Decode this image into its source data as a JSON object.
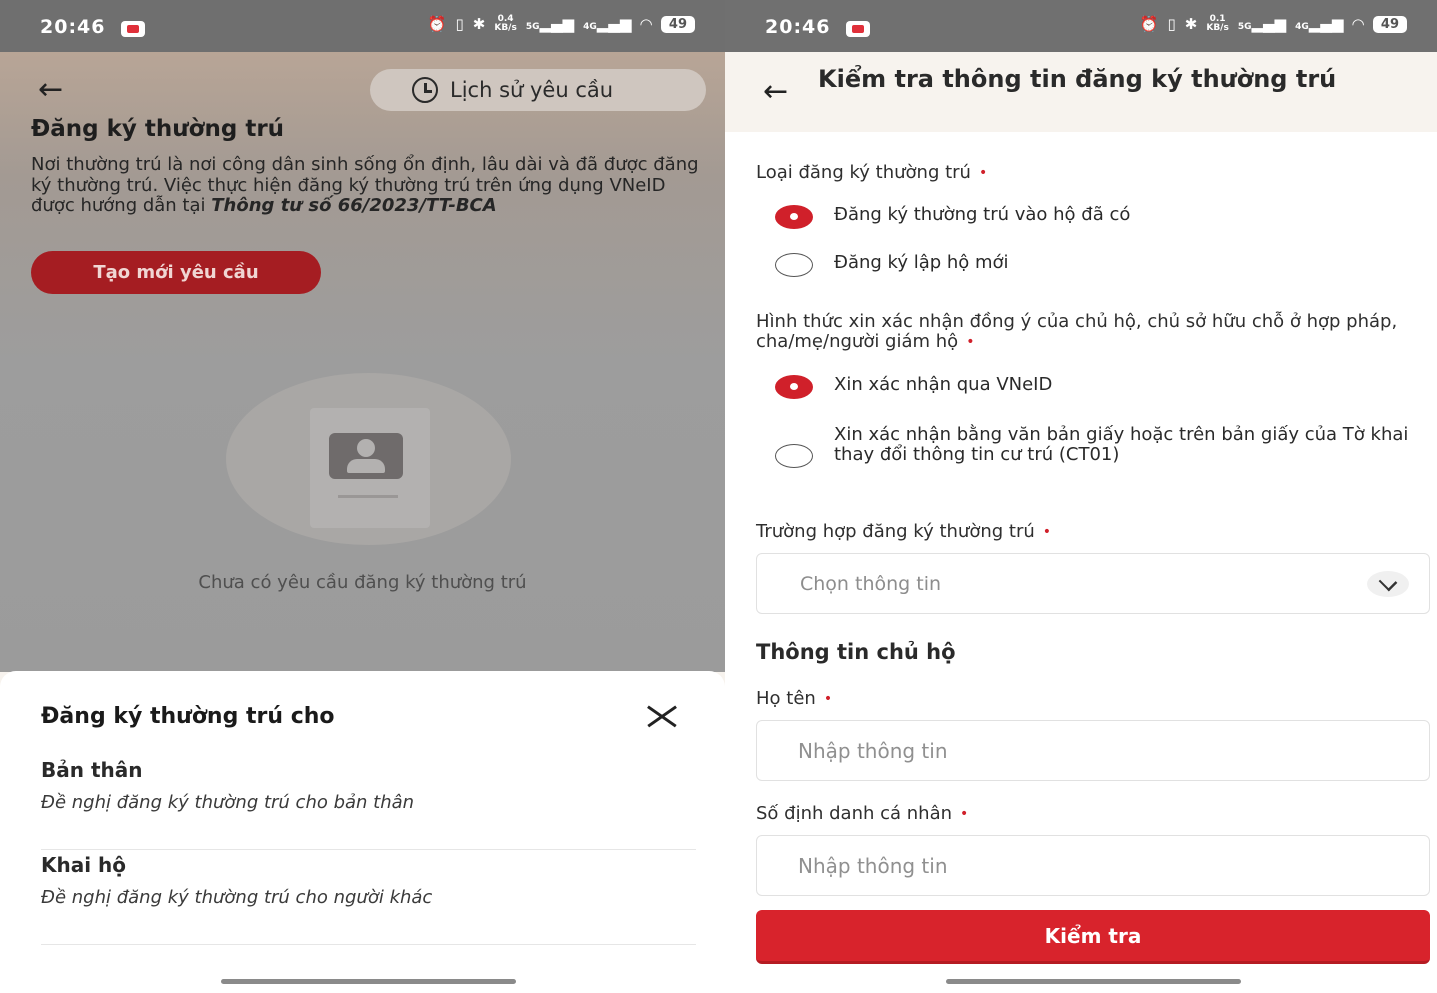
{
  "status_bar": {
    "left_time": "20:46",
    "right_time": "20:46",
    "left_speed": "0.4",
    "right_speed": "0.1",
    "speed_unit": "KB/s",
    "net_5g": "5G",
    "net_4g": "4G",
    "battery": "49"
  },
  "left": {
    "history_button": "Lịch sử yêu cầu",
    "title": "Đăng ký thường trú",
    "description": "Nơi thường trú là nơi công dân sinh sống ổn định, lâu dài và đã được đăng ký thường trú. Việc thực hiện đăng ký thường trú trên ứng dụng VNeID được hướng dẫn tại",
    "description_ref": "Thông tư số 66/2023/TT-BCA",
    "create_button": "Tạo mới yêu cầu",
    "empty_text": "Chưa có yêu cầu đăng ký thường trú",
    "sheet": {
      "title": "Đăng ký thường trú cho",
      "options": [
        {
          "title": "Bản thân",
          "subtitle": "Đề nghị đăng ký thường trú cho bản thân"
        },
        {
          "title": "Khai hộ",
          "subtitle": "Đề nghị đăng ký thường trú cho người khác"
        }
      ]
    }
  },
  "right": {
    "header_title": "Kiểm tra thông tin đăng ký thường trú",
    "registration_type": {
      "label": "Loại đăng ký thường trú",
      "options": [
        {
          "label": "Đăng ký thường trú vào hộ đã có",
          "selected": true
        },
        {
          "label": "Đăng ký lập hộ mới",
          "selected": false
        }
      ]
    },
    "consent_method": {
      "label": "Hình thức xin xác nhận đồng ý của chủ hộ, chủ sở hữu chỗ ở hợp pháp, cha/mẹ/người giám hộ",
      "options": [
        {
          "label": "Xin xác nhận qua VNeID",
          "selected": true
        },
        {
          "label": "Xin xác nhận bằng văn bản giấy hoặc trên bản giấy của Tờ khai thay đổi thông tin cư trú (CT01)",
          "selected": false
        }
      ]
    },
    "case": {
      "label": "Trường hợp đăng ký thường trú",
      "placeholder": "Chọn thông tin"
    },
    "section_title": "Thông tin chủ hộ",
    "name_field": {
      "label": "Họ tên",
      "placeholder": "Nhập thông tin"
    },
    "id_field": {
      "label": "Số định danh cá nhân",
      "placeholder": "Nhập thông tin"
    },
    "submit_button": "Kiểm tra",
    "required_mark": "•"
  },
  "colors": {
    "brand_red": "#d8232c",
    "dark_red": "#a51d22"
  }
}
